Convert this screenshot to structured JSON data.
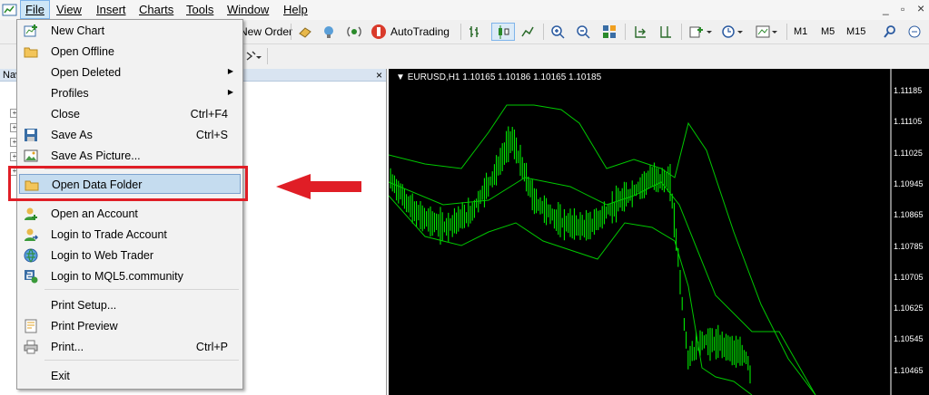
{
  "menubar": {
    "items": [
      "File",
      "View",
      "Insert",
      "Charts",
      "Tools",
      "Window",
      "Help"
    ],
    "window_controls": {
      "minimize": "_",
      "restore": "▫",
      "close": "×"
    }
  },
  "toolbar": {
    "new_order_label": "New Order",
    "autotrading_label": "AutoTrading",
    "timeframes": [
      "M1",
      "M5",
      "M15"
    ]
  },
  "navigator": {
    "title": "Nav"
  },
  "chart": {
    "label": "EURUSD,H1  1.10165 1.10186 1.10165 1.10185",
    "price_ticks": [
      "1.11185",
      "1.11105",
      "1.11025",
      "1.10945",
      "1.10865",
      "1.10785",
      "1.10705",
      "1.10625",
      "1.10545",
      "1.10465"
    ],
    "candle_color": "#00ff00",
    "band_color": "#00c800"
  },
  "file_menu": {
    "items": [
      {
        "label": "New Chart",
        "shortcut": "",
        "icon": "new-chart-icon"
      },
      {
        "label": "Open Offline",
        "shortcut": "",
        "icon": "folder-icon"
      },
      {
        "label": "Open Deleted",
        "shortcut": "",
        "submenu": true
      },
      {
        "label": "Profiles",
        "shortcut": "",
        "submenu": true
      },
      {
        "label": "Close",
        "shortcut": "Ctrl+F4"
      },
      {
        "label": "Save As",
        "shortcut": "Ctrl+S",
        "icon": "save-icon"
      },
      {
        "label": "Save As Picture...",
        "shortcut": "",
        "icon": "picture-icon"
      },
      {
        "label": "Open Data Folder",
        "shortcut": "",
        "icon": "folder-icon",
        "highlighted": true
      },
      {
        "label": "Open an Account",
        "shortcut": "",
        "icon": "add-account-icon"
      },
      {
        "label": "Login to Trade Account",
        "shortcut": "",
        "icon": "login-icon"
      },
      {
        "label": "Login to Web Trader",
        "shortcut": "",
        "icon": "web-trader-icon"
      },
      {
        "label": "Login to MQL5.community",
        "shortcut": "",
        "icon": "mql5-icon"
      },
      {
        "label": "Print Setup...",
        "shortcut": ""
      },
      {
        "label": "Print Preview",
        "shortcut": "",
        "icon": "print-preview-icon"
      },
      {
        "label": "Print...",
        "shortcut": "Ctrl+P",
        "icon": "printer-icon"
      },
      {
        "label": "Exit",
        "shortcut": ""
      }
    ],
    "submenu_arrow": "▶"
  },
  "annotation": {
    "color": "#e01e26"
  }
}
